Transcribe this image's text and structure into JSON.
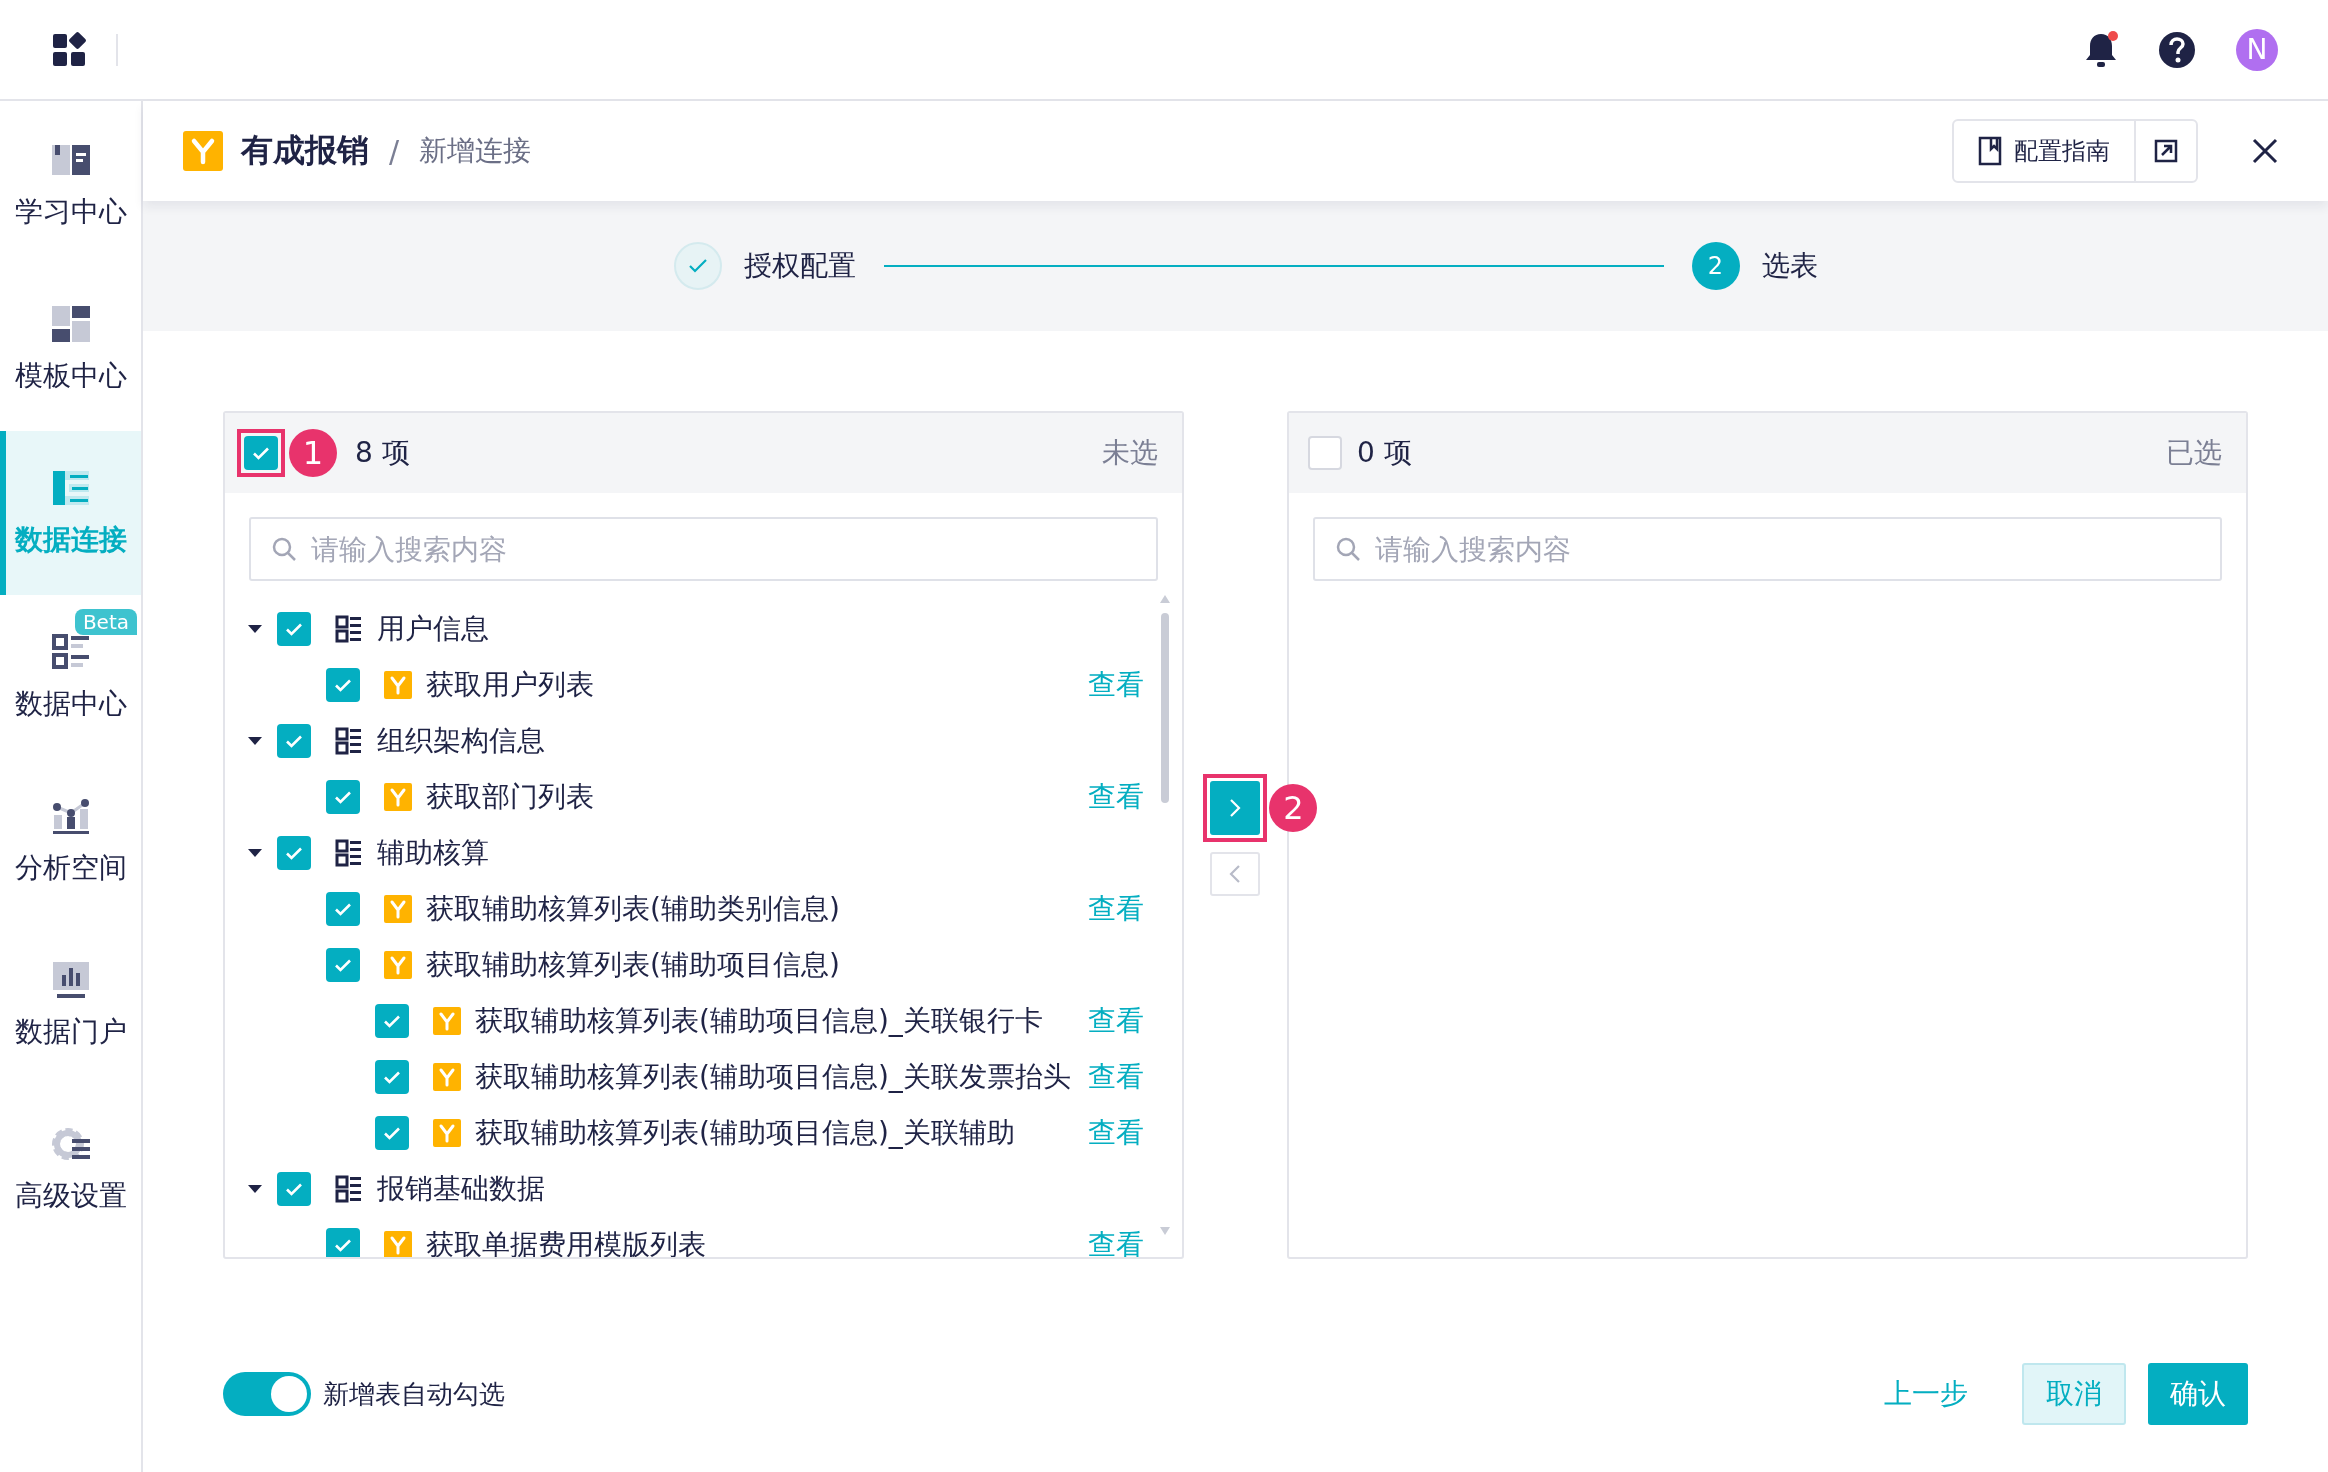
{
  "top_bar": {
    "unread": true,
    "avatar": "N"
  },
  "sidebar": {
    "items": [
      {
        "label": "学习中心",
        "kind": "learn",
        "selected": false
      },
      {
        "label": "模板中心",
        "kind": "template",
        "selected": false
      },
      {
        "label": "数据连接",
        "kind": "connect",
        "selected": true
      },
      {
        "label": "数据中心",
        "kind": "datacenter",
        "selected": false,
        "badge": "Beta"
      },
      {
        "label": "分析空间",
        "kind": "analysis",
        "selected": false
      },
      {
        "label": "数据门户",
        "kind": "portal",
        "selected": false
      },
      {
        "label": "高级设置",
        "kind": "settings",
        "selected": false
      }
    ]
  },
  "breadcrumb": {
    "app": "有成报销",
    "separator": "/",
    "page": "新增连接"
  },
  "header_actions": {
    "guide": "配置指南"
  },
  "steps": [
    {
      "label": "授权配置",
      "done": true
    },
    {
      "label": "选表",
      "number": "2",
      "done": false
    }
  ],
  "source_panel": {
    "all_checked": true,
    "count": "8 项",
    "title": "未选",
    "search_placeholder": "请输入搜索内容",
    "annotation": "1",
    "tree": [
      {
        "kind": "group",
        "label": "用户信息",
        "checked": true,
        "expanded": true,
        "children": [
          {
            "kind": "table",
            "label": "获取用户列表",
            "checked": true,
            "view": "查看"
          }
        ]
      },
      {
        "kind": "group",
        "label": "组织架构信息",
        "checked": true,
        "expanded": true,
        "children": [
          {
            "kind": "table",
            "label": "获取部门列表",
            "checked": true,
            "view": "查看"
          }
        ]
      },
      {
        "kind": "group",
        "label": "辅助核算",
        "checked": true,
        "expanded": true,
        "children": [
          {
            "kind": "table",
            "label": "获取辅助核算列表(辅助类别信息)",
            "checked": true,
            "view": "查看"
          },
          {
            "kind": "table",
            "label": "获取辅助核算列表(辅助项目信息)",
            "checked": true,
            "children": [
              {
                "kind": "table",
                "label": "获取辅助核算列表(辅助项目信息)_关联银行卡",
                "checked": true,
                "view": "查看"
              },
              {
                "kind": "table",
                "label": "获取辅助核算列表(辅助项目信息)_关联发票抬头",
                "checked": true,
                "view": "查看"
              },
              {
                "kind": "table",
                "label": "获取辅助核算列表(辅助项目信息)_关联辅助",
                "checked": true,
                "view": "查看"
              }
            ]
          }
        ]
      },
      {
        "kind": "group",
        "label": "报销基础数据",
        "checked": true,
        "expanded": true,
        "children": [
          {
            "kind": "table",
            "label": "获取单据费用模版列表",
            "checked": true,
            "view": "查看"
          }
        ]
      }
    ]
  },
  "target_panel": {
    "all_checked": false,
    "count": "0 项",
    "title": "已选",
    "search_placeholder": "请输入搜索内容"
  },
  "transfer_buttons": [
    {
      "kind": "right",
      "disabled": false,
      "annotation": "2"
    },
    {
      "kind": "left",
      "disabled": true
    }
  ],
  "footer": {
    "auto_select": {
      "label": "新增表自动勾选",
      "on": true
    },
    "buttons": [
      {
        "label": "上一步",
        "kind": "link"
      },
      {
        "label": "取消",
        "kind": "secondary"
      },
      {
        "label": "确认",
        "kind": "primary"
      }
    ]
  }
}
